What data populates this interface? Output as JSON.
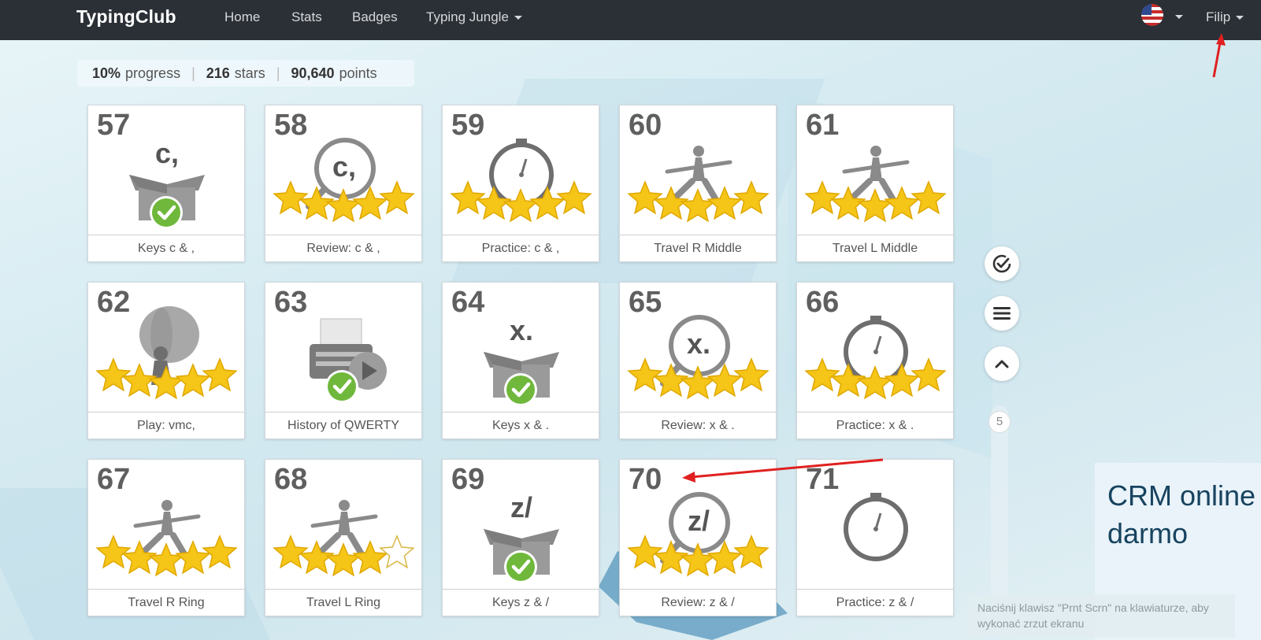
{
  "navbar": {
    "brand": "TypingClub",
    "links": [
      "Home",
      "Stats",
      "Badges",
      "Typing Jungle"
    ],
    "user": "Filip",
    "language_icon": "us-flag-icon"
  },
  "stats": {
    "progress_value": "10%",
    "progress_label": "progress",
    "stars_value": "216",
    "stars_label": "stars",
    "points_value": "90,640",
    "points_label": "points",
    "separator": "|"
  },
  "lessons": [
    {
      "num": "57",
      "label": "Keys c & ,",
      "art": "keys",
      "key": "c,",
      "stars": -1
    },
    {
      "num": "58",
      "label": "Review: c & ,",
      "art": "review",
      "key": "c,",
      "stars": 5
    },
    {
      "num": "59",
      "label": "Practice: c & ,",
      "art": "timer",
      "stars": 5
    },
    {
      "num": "60",
      "label": "Travel R Middle",
      "art": "yoga",
      "stars": 5
    },
    {
      "num": "61",
      "label": "Travel L Middle",
      "art": "yoga",
      "stars": 5
    },
    {
      "num": "62",
      "label": "Play: vmc,",
      "art": "balloon",
      "stars": 5
    },
    {
      "num": "63",
      "label": "History of QWERTY",
      "art": "typewriter",
      "stars": -1
    },
    {
      "num": "64",
      "label": "Keys x & .",
      "art": "keys",
      "key": "x.",
      "stars": -1
    },
    {
      "num": "65",
      "label": "Review: x & .",
      "art": "review",
      "key": "x.",
      "stars": 5
    },
    {
      "num": "66",
      "label": "Practice: x & .",
      "art": "timer",
      "stars": 5
    },
    {
      "num": "67",
      "label": "Travel R Ring",
      "art": "yoga",
      "stars": 5
    },
    {
      "num": "68",
      "label": "Travel L Ring",
      "art": "yoga",
      "stars": 4
    },
    {
      "num": "69",
      "label": "Keys z & /",
      "art": "keys",
      "key": "z/",
      "stars": -1
    },
    {
      "num": "70",
      "label": "Review: z & /",
      "art": "review",
      "key": "z/",
      "stars": 5
    },
    {
      "num": "71",
      "label": "Practice: z & /",
      "art": "timer",
      "stars": 0
    }
  ],
  "side": {
    "buttons": [
      "check-icon",
      "menu-icon",
      "chevron-up-icon"
    ],
    "scroll_value": "5"
  },
  "ad": {
    "text": "CRM online\ndarmo"
  },
  "toast": {
    "text": "Naciśnij klawisz \"Prnt Scrn\" na klawiaturze, aby wykonać zrzut ekranu"
  },
  "colors": {
    "navbar": "#2b3036",
    "star": "#f5c518",
    "check": "#6fb83b",
    "annotation": "#e02020"
  }
}
